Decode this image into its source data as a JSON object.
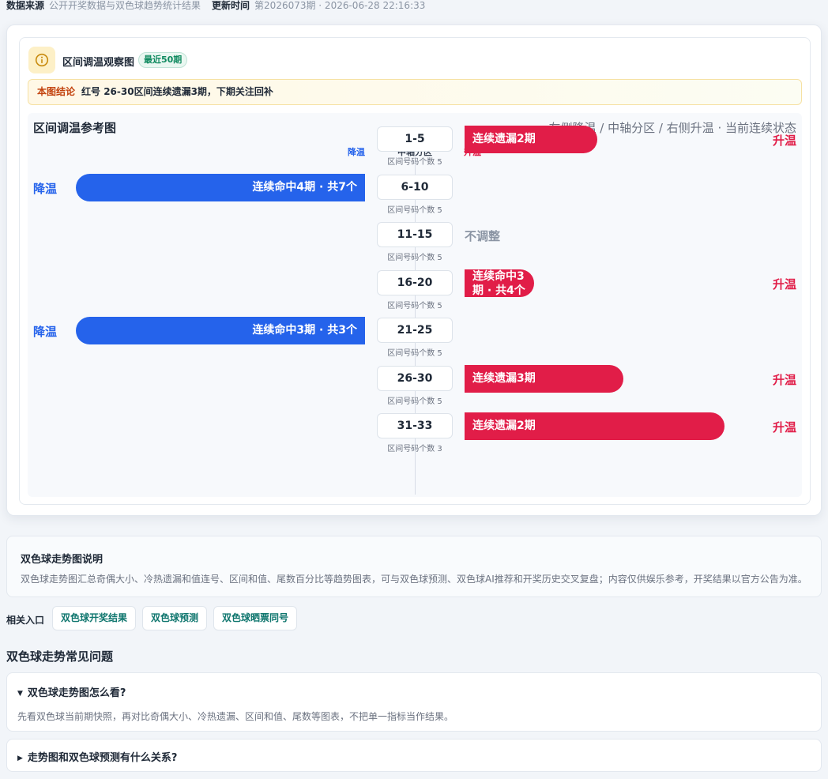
{
  "meta": {
    "source_label": "数据来源",
    "source_value": "公开开奖数据与双色球趋势统计结果",
    "update_label": "更新时间",
    "update_value": "第2026073期 · 2026-06-28 22:16:33"
  },
  "panel": {
    "title": "区间调温观察图",
    "badge": "最近50期",
    "conclusion_tag": "本图结论",
    "conclusion_text": "红号 26-30区间连续遗漏3期，下期关注回补"
  },
  "chart": {
    "title": "区间调温参考图",
    "note": "左侧降温 / 中轴分区 / 右侧升温 · 当前连续状态",
    "legend_cool": "降温",
    "legend_axis": "中轴分区",
    "legend_heat": "升温",
    "no_adjust_label": "不调整"
  },
  "chart_data": {
    "type": "bar",
    "categories": [
      "1-5",
      "6-10",
      "11-15",
      "16-20",
      "21-25",
      "26-30",
      "31-33"
    ],
    "zone_sub": [
      "区间号码个数 5",
      "区间号码个数 5",
      "区间号码个数 5",
      "区间号码个数 5",
      "区间号码个数 5",
      "区间号码个数 5",
      "区间号码个数 3"
    ],
    "status": [
      "升温",
      "降温",
      "不调整",
      "升温",
      "降温",
      "升温",
      "升温"
    ],
    "bar_labels": [
      "连续遗漏2期",
      "连续命中4期 · 共7个",
      "",
      "连续命中3期 · 共4个",
      "连续命中3期 · 共3个",
      "连续遗漏3期",
      "连续遗漏2期"
    ]
  },
  "description": {
    "title": "双色球走势图说明",
    "body": "双色球走势图汇总奇偶大小、冷热遗漏和值连号、区间和值、尾数百分比等趋势图表，可与双色球预测、双色球AI推荐和开奖历史交叉复盘；内容仅供娱乐参考，开奖结果以官方公告为准。"
  },
  "links": {
    "label": "相关入口",
    "items": [
      "双色球开奖结果",
      "双色球预测",
      "双色球晒票同号"
    ]
  },
  "faq": {
    "title": "双色球走势常见问题",
    "items": [
      {
        "q": "双色球走势图怎么看?",
        "a": "先看双色球当前期快照，再对比奇偶大小、冷热遗漏、区间和值、尾数等图表，不把单一指标当作结果。",
        "open": true
      },
      {
        "q": "走势图和双色球预测有什么关系?",
        "a": "",
        "open": false
      }
    ]
  },
  "colors": {
    "cool": "#2563eb",
    "heat": "#e11d48",
    "neutral": "#8a94a3",
    "accent_green": "#0f766e"
  }
}
